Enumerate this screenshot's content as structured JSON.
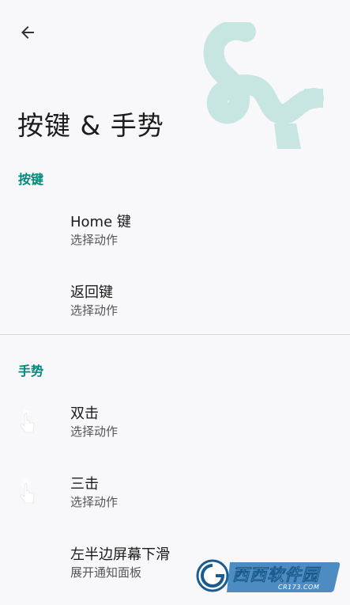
{
  "header": {
    "back_icon": "arrow-left-icon",
    "title": "按键 & 手势",
    "decoration_icon": "squiggle-illustration",
    "decoration_color": "#c7e6e2"
  },
  "sections": {
    "keys": {
      "header": "按键",
      "items": [
        {
          "title": "Home 键",
          "subtitle": "选择动作"
        },
        {
          "title": "返回键",
          "subtitle": "选择动作"
        }
      ]
    },
    "gestures": {
      "header": "手势",
      "items": [
        {
          "title": "双击",
          "subtitle": "选择动作",
          "icon": "double-tap-icon"
        },
        {
          "title": "三击",
          "subtitle": "选择动作",
          "icon": "triple-tap-icon"
        },
        {
          "title": "左半边屏幕下滑",
          "subtitle": "展开通知面板"
        }
      ]
    }
  },
  "watermark": {
    "logo_text": "西西软件园",
    "domain": "CR173.COM"
  },
  "colors": {
    "accent": "#00897b",
    "background": "#f8f8fa",
    "divider": "#dcdcdc"
  }
}
